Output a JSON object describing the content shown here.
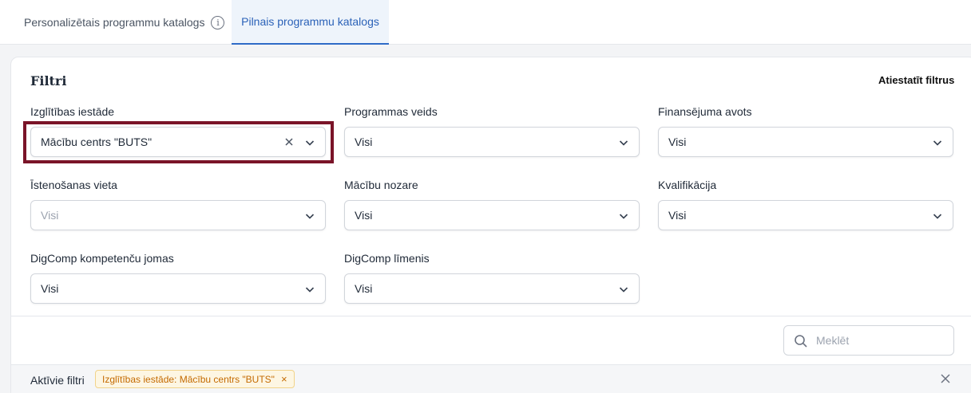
{
  "tabs": [
    {
      "label": "Personalizētais programmu katalogs",
      "info_icon": "info-icon"
    },
    {
      "label": "Pilnais programmu katalogs",
      "active": true
    }
  ],
  "filters": {
    "title": "Filtri",
    "reset_label": "Atiestatīt filtrus",
    "fields": [
      {
        "label": "Izglītības iestāde",
        "value": "Mācību centrs \"BUTS\"",
        "clearable": true
      },
      {
        "label": "Programmas veids",
        "value": "Visi"
      },
      {
        "label": "Finansējuma avots",
        "value": "Visi"
      },
      {
        "label": "Īstenošanas vieta",
        "value": "Visi",
        "placeholder": true
      },
      {
        "label": "Mācību nozare",
        "value": "Visi"
      },
      {
        "label": "Kvalifikācija",
        "value": "Visi"
      },
      {
        "label": "DigComp kompetenču jomas",
        "value": "Visi"
      },
      {
        "label": "DigComp līmenis",
        "value": "Visi"
      }
    ]
  },
  "search": {
    "placeholder": "Meklēt"
  },
  "active_filters": {
    "label": "Aktīvie filtri",
    "chips": [
      {
        "text": "Izglītības iestāde: Mācību centrs \"BUTS\""
      }
    ]
  },
  "colors": {
    "accent": "#2f6bc7",
    "highlight": "#7a1428",
    "chip_text": "#c46a00"
  }
}
